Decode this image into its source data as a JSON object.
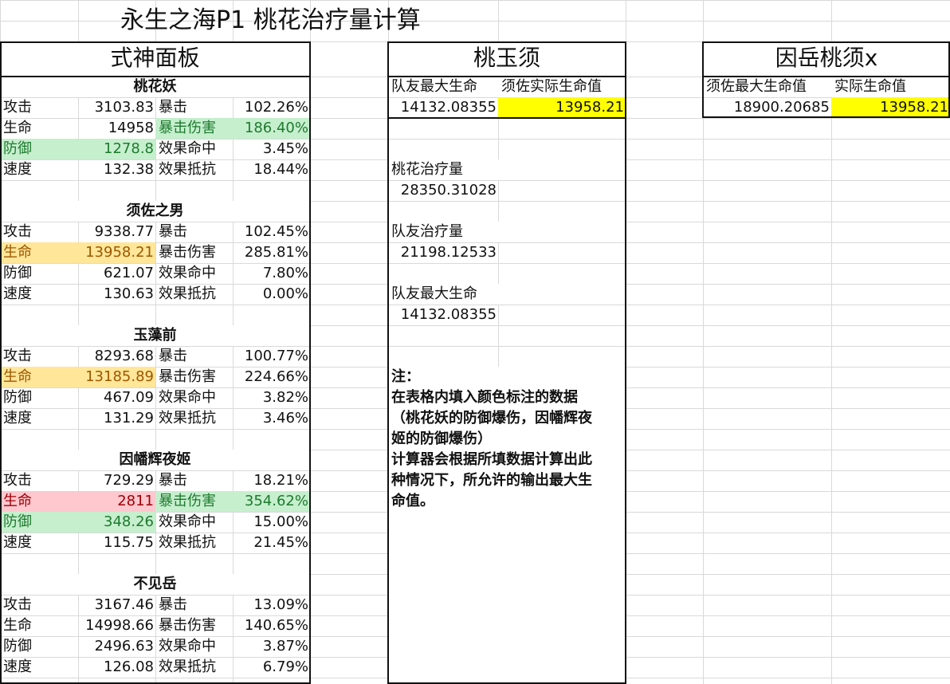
{
  "title": "永生之海P1 桃花治疗量计算",
  "panel": {
    "header": "式神面板",
    "characters": [
      {
        "name": "桃花妖",
        "rows": [
          {
            "stat": "攻击",
            "value": "3103.83",
            "stat2": "暴击",
            "value2": "102.26%"
          },
          {
            "stat": "生命",
            "value": "14958",
            "stat2": "暴击伤害",
            "value2": "186.40%"
          },
          {
            "stat": "防御",
            "value": "1278.8",
            "stat2": "效果命中",
            "value2": "3.45%"
          },
          {
            "stat": "速度",
            "value": "132.38",
            "stat2": "效果抵抗",
            "value2": "18.44%"
          }
        ]
      },
      {
        "name": "须佐之男",
        "rows": [
          {
            "stat": "攻击",
            "value": "9338.77",
            "stat2": "暴击",
            "value2": "102.45%"
          },
          {
            "stat": "生命",
            "value": "13958.21",
            "stat2": "暴击伤害",
            "value2": "285.81%"
          },
          {
            "stat": "防御",
            "value": "621.07",
            "stat2": "效果命中",
            "value2": "7.80%"
          },
          {
            "stat": "速度",
            "value": "130.63",
            "stat2": "效果抵抗",
            "value2": "0.00%"
          }
        ]
      },
      {
        "name": "玉藻前",
        "rows": [
          {
            "stat": "攻击",
            "value": "8293.68",
            "stat2": "暴击",
            "value2": "100.77%"
          },
          {
            "stat": "生命",
            "value": "13185.89",
            "stat2": "暴击伤害",
            "value2": "224.66%"
          },
          {
            "stat": "防御",
            "value": "467.09",
            "stat2": "效果命中",
            "value2": "3.82%"
          },
          {
            "stat": "速度",
            "value": "131.29",
            "stat2": "效果抵抗",
            "value2": "3.46%"
          }
        ]
      },
      {
        "name": "因幡辉夜姬",
        "rows": [
          {
            "stat": "攻击",
            "value": "729.29",
            "stat2": "暴击",
            "value2": "18.21%"
          },
          {
            "stat": "生命",
            "value": "2811",
            "stat2": "暴击伤害",
            "value2": "354.62%"
          },
          {
            "stat": "防御",
            "value": "348.26",
            "stat2": "效果命中",
            "value2": "15.00%"
          },
          {
            "stat": "速度",
            "value": "115.75",
            "stat2": "效果抵抗",
            "value2": "21.45%"
          }
        ]
      },
      {
        "name": "不见岳",
        "rows": [
          {
            "stat": "攻击",
            "value": "3167.46",
            "stat2": "暴击",
            "value2": "13.09%"
          },
          {
            "stat": "生命",
            "value": "14998.66",
            "stat2": "暴击伤害",
            "value2": "140.65%"
          },
          {
            "stat": "防御",
            "value": "2496.63",
            "stat2": "效果命中",
            "value2": "3.87%"
          },
          {
            "stat": "速度",
            "value": "126.08",
            "stat2": "效果抵抗",
            "value2": "6.79%"
          }
        ]
      }
    ]
  },
  "taoyuxu": {
    "header": "桃玉须",
    "col1_label": "队友最大生命",
    "col2_label": "须佐实际生命值",
    "col1_value": "14132.08355",
    "col2_value": "13958.21",
    "heal_label": "桃花治疗量",
    "heal_value": "28350.31028",
    "ally_heal_label": "队友治疗量",
    "ally_heal_value": "21198.12533",
    "ally_maxhp_label": "队友最大生命",
    "ally_maxhp_value": "14132.08355",
    "note_lines": [
      "注：",
      "在表格内填入颜色标注的数据",
      "（桃花妖的防御爆伤，因幡辉夜",
      "姬的防御爆伤）",
      "计算器会根据所填数据计算出此",
      "种情况下，所允许的输出最大生",
      "命值。"
    ]
  },
  "yinyue": {
    "header": "因岳桃须x",
    "col1_label": "须佐最大生命值",
    "col2_label": "实际生命值",
    "col1_value": "18900.20685",
    "col2_value": "13958.21"
  },
  "colors": {
    "green_fill": "#c6efce",
    "orange_fill": "#ffe699",
    "red_fill": "#ffc7ce",
    "yellow_fill": "#ffff00",
    "gridline": "#d9d9d9"
  }
}
